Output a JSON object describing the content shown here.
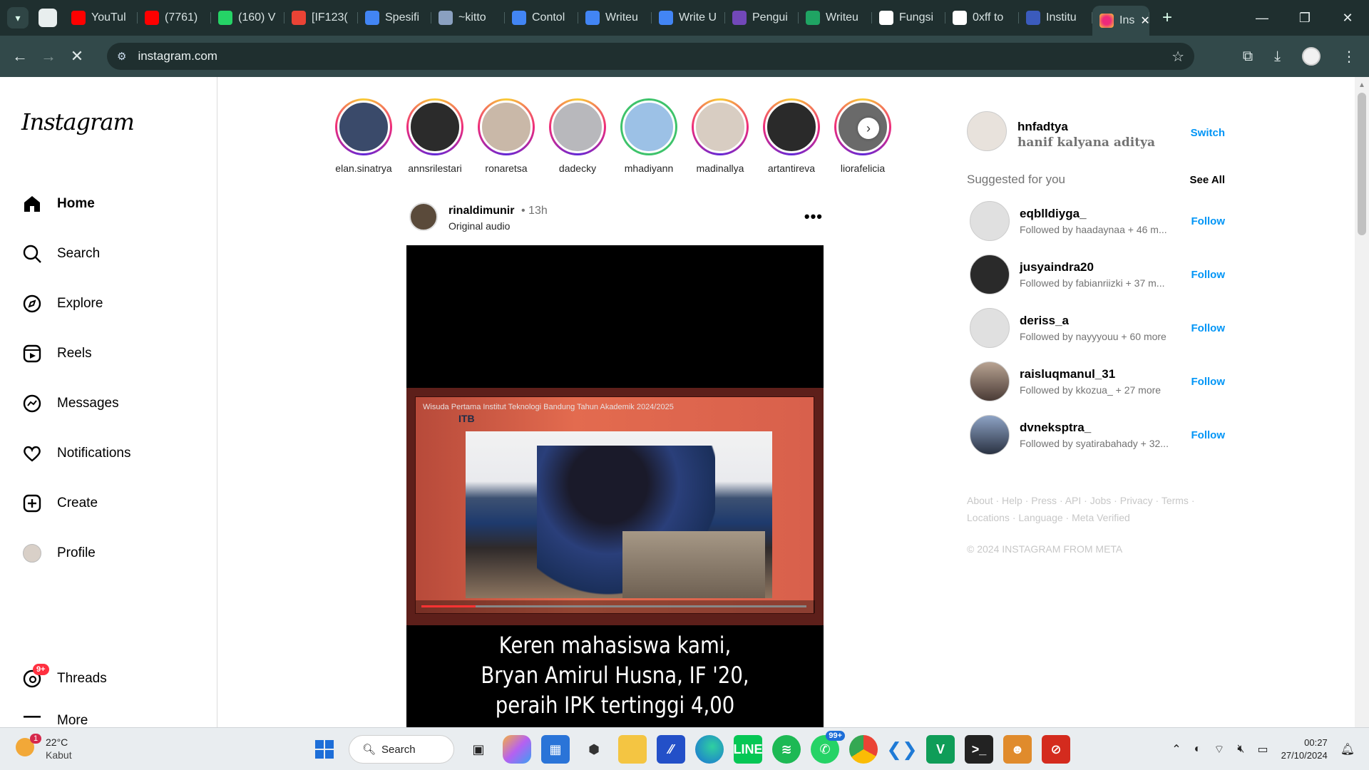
{
  "browser": {
    "tabs": [
      {
        "label": "YouTul",
        "favicon": "youtube-icon",
        "color": "#ff0000"
      },
      {
        "label": "(7761)",
        "favicon": "youtube-icon",
        "color": "#ff0000"
      },
      {
        "label": "(160) V",
        "favicon": "whatsapp-icon",
        "color": "#25d366"
      },
      {
        "label": "[IF123(",
        "favicon": "gmail-icon",
        "color": "#ea4335"
      },
      {
        "label": "Spesifi",
        "favicon": "docs-icon",
        "color": "#4285f4"
      },
      {
        "label": "~kitto",
        "favicon": "image-icon",
        "color": "#8aa0c0"
      },
      {
        "label": "Contol",
        "favicon": "docs-icon",
        "color": "#4285f4"
      },
      {
        "label": "Writeu",
        "favicon": "docs-icon",
        "color": "#4285f4"
      },
      {
        "label": "Write U",
        "favicon": "docs-icon",
        "color": "#4285f4"
      },
      {
        "label": "Pengui",
        "favicon": "forms-icon",
        "color": "#7248b9"
      },
      {
        "label": "Writeu",
        "favicon": "drive-icon",
        "color": "#1fa463"
      },
      {
        "label": "Fungsi",
        "favicon": "openai-icon",
        "color": "#ffffff"
      },
      {
        "label": "0xff to",
        "favicon": "google-icon",
        "color": "#ffffff"
      },
      {
        "label": "Institu",
        "favicon": "itb-icon",
        "color": "#3b5bbd"
      }
    ],
    "active_tab": {
      "label": "Ins",
      "favicon": "instagram-icon"
    },
    "url": "instagram.com"
  },
  "instagram": {
    "logo": "Instagram",
    "nav": [
      {
        "label": "Home",
        "icon": "home-icon"
      },
      {
        "label": "Search",
        "icon": "search-icon"
      },
      {
        "label": "Explore",
        "icon": "compass-icon"
      },
      {
        "label": "Reels",
        "icon": "reels-icon"
      },
      {
        "label": "Messages",
        "icon": "messenger-icon"
      },
      {
        "label": "Notifications",
        "icon": "heart-icon"
      },
      {
        "label": "Create",
        "icon": "plus-square-icon"
      },
      {
        "label": "Profile",
        "icon": "avatar"
      }
    ],
    "threads": {
      "label": "Threads",
      "badge": "9+"
    },
    "more": {
      "label": "More"
    },
    "stories": [
      {
        "name": "elan.sinatrya",
        "ring": "gradient",
        "color": "#3a4a6a"
      },
      {
        "name": "annsrilestari",
        "ring": "gradient",
        "color": "#2b2b2b"
      },
      {
        "name": "ronaretsa",
        "ring": "gradient",
        "color": "#c9b8a8"
      },
      {
        "name": "dadecky",
        "ring": "gradient",
        "color": "#b8b8bc"
      },
      {
        "name": "mhadiyann",
        "ring": "green",
        "color": "#9cc1e6"
      },
      {
        "name": "madinallya",
        "ring": "gradient",
        "color": "#d8cdc2"
      },
      {
        "name": "artantireva",
        "ring": "gradient",
        "color": "#2a2a2a"
      },
      {
        "name": "liorafelicia",
        "ring": "gradient",
        "color": "#6a6a6a"
      }
    ],
    "post": {
      "user": "rinaldimunir",
      "time": "• 13h",
      "audio": "Original audio",
      "screen_title": "Wisuda Pertama Institut Teknologi Bandung Tahun Akademik 2024/2025",
      "screen_logo": "ITB",
      "caption_lines": [
        "Keren mahasiswa kami,",
        "Bryan Amirul Husna, IF '20,",
        "peraih IPK tertinggi 4,00"
      ],
      "video_progress_percent": 14
    },
    "me": {
      "username": "hnfadtya",
      "fullname": "hanif kalyana aditya",
      "switch": "Switch"
    },
    "suggested_title": "Suggested for you",
    "see_all": "See All",
    "suggestions": [
      {
        "username": "eqblldiyga_",
        "followed_by": "Followed by haadaynaa + 46 m...",
        "follow": "Follow",
        "avatar": "grey"
      },
      {
        "username": "jusyaindra20",
        "followed_by": "Followed by fabianriizki + 37 m...",
        "follow": "Follow",
        "avatar": "dark"
      },
      {
        "username": "deriss_a",
        "followed_by": "Followed by nayyyouu + 60 more",
        "follow": "Follow",
        "avatar": "grey"
      },
      {
        "username": "raisluqmanul_31",
        "followed_by": "Followed by kkozua_ + 27 more",
        "follow": "Follow",
        "avatar": "mount"
      },
      {
        "username": "dvneksptra_",
        "followed_by": "Followed by syatirabahady + 32...",
        "follow": "Follow",
        "avatar": "city"
      }
    ],
    "footer_links": "About · Help · Press · API · Jobs · Privacy · Terms · Locations · Language · Meta Verified",
    "copyright": "© 2024 INSTAGRAM FROM META"
  },
  "taskbar": {
    "weather_temp": "22°C",
    "weather_cond": "Kabut",
    "weather_badge": "1",
    "search_label": "Search",
    "whatsapp_badge": "99+",
    "time": "00:27",
    "date": "27/10/2024"
  },
  "colors": {
    "accent": "#0095f6",
    "chrome_dark": "#1f2f2f",
    "chrome_bar": "#32494a"
  }
}
